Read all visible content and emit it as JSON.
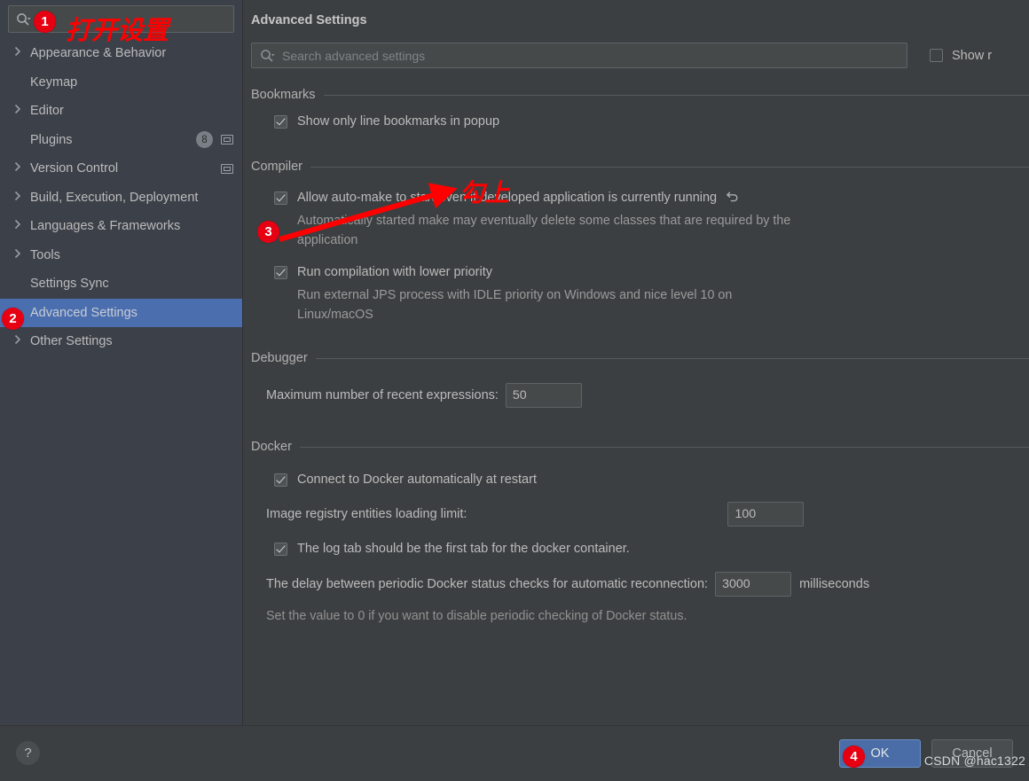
{
  "sidebar": {
    "search": {
      "placeholder": "",
      "value": "",
      "icon": "search-icon"
    },
    "items": [
      {
        "label": "Appearance & Behavior",
        "expandable": true,
        "selected": false,
        "badge": "",
        "project_icon": false
      },
      {
        "label": "Keymap",
        "expandable": false,
        "selected": false,
        "badge": "",
        "project_icon": false
      },
      {
        "label": "Editor",
        "expandable": true,
        "selected": false,
        "badge": "",
        "project_icon": false
      },
      {
        "label": "Plugins",
        "expandable": false,
        "selected": false,
        "badge": "8",
        "project_icon": true
      },
      {
        "label": "Version Control",
        "expandable": true,
        "selected": false,
        "badge": "",
        "project_icon": true
      },
      {
        "label": "Build, Execution, Deployment",
        "expandable": true,
        "selected": false,
        "badge": "",
        "project_icon": false
      },
      {
        "label": "Languages & Frameworks",
        "expandable": true,
        "selected": false,
        "badge": "",
        "project_icon": false
      },
      {
        "label": "Tools",
        "expandable": true,
        "selected": false,
        "badge": "",
        "project_icon": false
      },
      {
        "label": "Settings Sync",
        "expandable": false,
        "selected": false,
        "badge": "",
        "project_icon": false
      },
      {
        "label": "Advanced Settings",
        "expandable": false,
        "selected": true,
        "badge": "",
        "project_icon": false
      },
      {
        "label": "Other Settings",
        "expandable": true,
        "selected": false,
        "badge": "",
        "project_icon": false
      }
    ]
  },
  "content": {
    "title": "Advanced Settings",
    "search": {
      "placeholder": "Search advanced settings",
      "value": "",
      "icon": "search-icon"
    },
    "show_modified": {
      "label": "Show r",
      "checked": false
    },
    "groups": {
      "bookmarks": {
        "title": "Bookmarks",
        "option_1": {
          "label": "Show only line bookmarks in popup",
          "checked": true
        }
      },
      "compiler": {
        "title": "Compiler",
        "option_1": {
          "label": "Allow auto-make to start even if developed application is currently running",
          "checked": true,
          "revert_icon": "revert-icon",
          "description": "Automatically started make may eventually delete some classes that are required by the application"
        },
        "option_2": {
          "label": "Run compilation with lower priority",
          "checked": true,
          "description": "Run external JPS process with IDLE priority on Windows and nice level 10 on Linux/macOS"
        }
      },
      "debugger": {
        "title": "Debugger",
        "field_1": {
          "label": "Maximum number of recent expressions:",
          "value": "50"
        }
      },
      "docker": {
        "title": "Docker",
        "option_1": {
          "label": "Connect to Docker automatically at restart",
          "checked": true
        },
        "field_1": {
          "label": "Image registry entities loading limit:",
          "value": "100"
        },
        "option_2": {
          "label": "The log tab should be the first tab for the docker container.",
          "checked": true
        },
        "field_2": {
          "label": "The delay between periodic Docker status checks for automatic reconnection:",
          "value": "3000",
          "unit": "milliseconds"
        },
        "note": "Set the value to 0 if you want to disable periodic checking of Docker status."
      }
    }
  },
  "bottom": {
    "help_label": "?",
    "ok_label": "OK",
    "cancel_label": "Cancel",
    "watermark": "CSDN @hac1322"
  },
  "annotations": {
    "marker_1": "1",
    "marker_2": "2",
    "marker_3": "3",
    "marker_4": "4",
    "note_open_settings": "打开设置",
    "note_check_it": "勾上",
    "color": "#FF0000"
  }
}
